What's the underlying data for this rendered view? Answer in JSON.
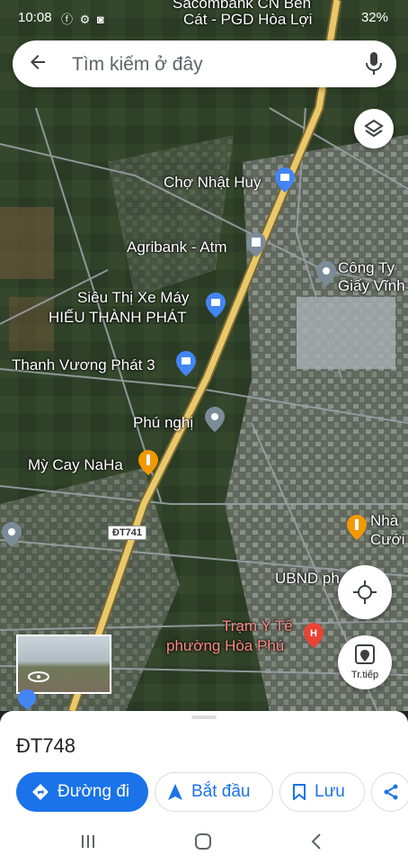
{
  "status": {
    "time": "10:08",
    "battery": "32%"
  },
  "search": {
    "placeholder": "Tìm kiếm ở đây"
  },
  "top_labels": {
    "line1": "Sacombank CN Bến",
    "line2": "Cát - PGD Hòa Lợi"
  },
  "places": {
    "cho_nhat_huy": "Chợ Nhật Huy",
    "agribank": "Agribank - Atm",
    "cong_ty_1": "Công Ty",
    "cong_ty_2": "Giấy Vĩnh",
    "sieu_thi_1": "Siêu Thị Xe Máy",
    "sieu_thi_2": "HIẾU THÀNH PHÁT",
    "thanh_vuong": "Thanh Vương Phát 3",
    "phu_nghi": "Phú nghị",
    "my_cay": "Mỳ Cay NaHa",
    "nha_1": "Nhà",
    "nha_2": "Cưới",
    "ubnd": "UBND ph... Hò",
    "tram_1": "Trạm Y Tế",
    "tram_2": "phường Hòa Phú",
    "road_shield": "ĐT741"
  },
  "controls": {
    "next_label": "Tr.tiếp"
  },
  "sheet": {
    "place_name": "ĐT748",
    "directions_label": "Đường đi",
    "start_label": "Bắt đầu",
    "save_label": "Lưu"
  },
  "colors": {
    "accent": "#1a73e8",
    "main_road": "#e8c86a",
    "health_pin": "#ea4335",
    "food_pin": "#f29900",
    "shop_pin": "#4285f4"
  },
  "icons": [
    "back-arrow-icon",
    "mic-icon",
    "layers-icon",
    "my-location-icon",
    "street-view-icon",
    "directions-icon",
    "navigation-icon",
    "bookmark-icon",
    "share-icon"
  ]
}
